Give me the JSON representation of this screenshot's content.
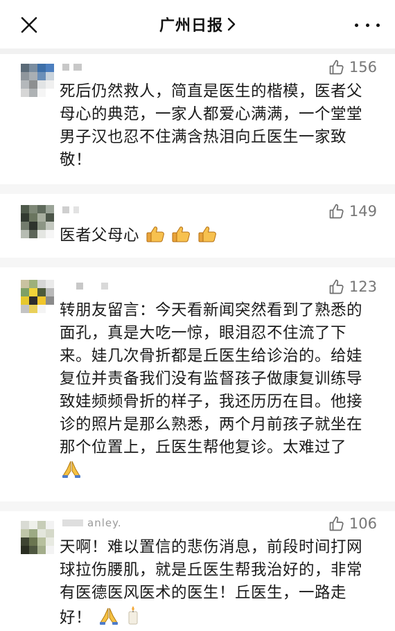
{
  "header": {
    "title": "广州日报",
    "chevron": ">",
    "close_icon": "close-icon",
    "more_icon": "more-dots-icon"
  },
  "comments": [
    {
      "nickname": "",
      "likes": "156",
      "text": "死后仍然救人，简直是医生的楷模，医者父母心的典范，一家人都爱心满满，一个堂堂男子汉也忍不住满含热泪向丘医生一家致敬！"
    },
    {
      "nickname": "",
      "likes": "149",
      "text": "医者父母心",
      "emojis": [
        "thumbs-up-icon",
        "thumbs-up-icon",
        "thumbs-up-icon"
      ]
    },
    {
      "nickname": "",
      "likes": "123",
      "text": "转朋友留言：今天看新闻突然看到了熟悉的面孔，真是大吃一惊，眼泪忍不住流了下来。娃几次骨折都是丘医生给诊治的。给娃复位并责备我们没有监督孩子做康复训练导致娃频频骨折的样子，我还历历在目。他接诊的照片是那么熟悉，两个月前孩子就坐在那个位置上，丘医生帮他复诊。太难过了",
      "emojis": [
        "praying-hands-icon"
      ]
    },
    {
      "nickname": "anley.",
      "likes": "106",
      "text": "天啊！难以置信的悲伤消息，前段时间打网球拉伤腰肌，就是丘医生帮我治好的，非常有医德医风医术的医生！丘医生，一路走好！",
      "emojis": [
        "praying-hands-icon",
        "candle-icon"
      ]
    }
  ]
}
